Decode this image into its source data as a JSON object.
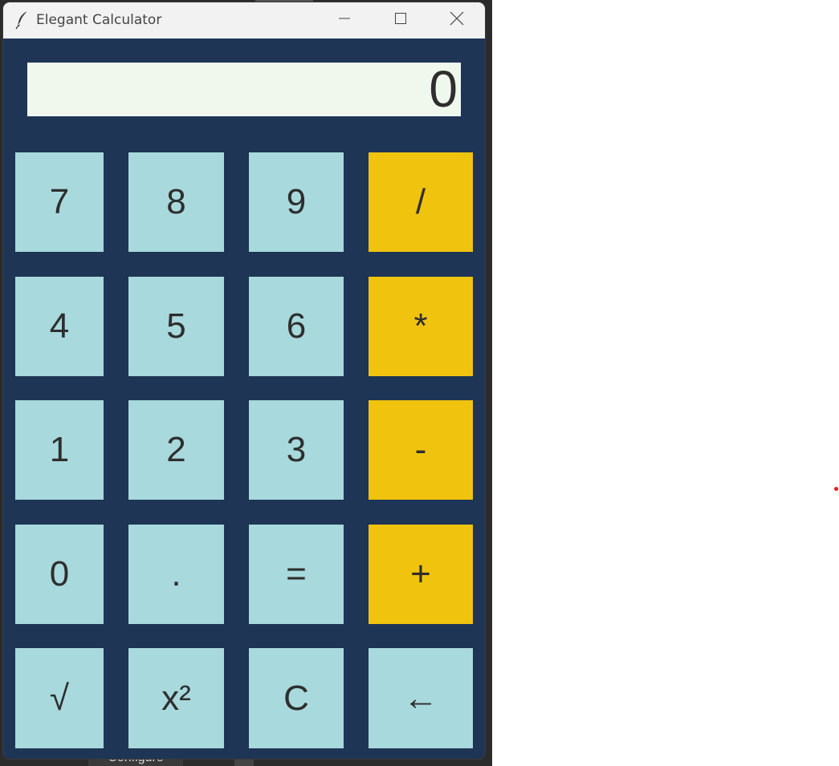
{
  "background": {
    "bottom_tab_label": "Configure"
  },
  "window": {
    "title": "Elegant Calculator",
    "icon": "feather-icon",
    "controls": {
      "minimize_icon": "minimize-icon",
      "maximize_icon": "maximize-icon",
      "close_icon": "close-icon"
    }
  },
  "display": {
    "value": "0"
  },
  "keys": {
    "row1": [
      "7",
      "8",
      "9",
      "/"
    ],
    "row2": [
      "4",
      "5",
      "6",
      "*"
    ],
    "row3": [
      "1",
      "2",
      "3",
      "-"
    ],
    "row4": [
      "0",
      ".",
      "=",
      "+"
    ],
    "row5": [
      "√",
      "x²",
      "C",
      "←"
    ]
  },
  "colors": {
    "window_background": "#1e3555",
    "display_background": "#f0f8ee",
    "key_background": "#a8d9dc",
    "operator_background": "#f0c30f",
    "key_text": "#2e2e2e"
  }
}
